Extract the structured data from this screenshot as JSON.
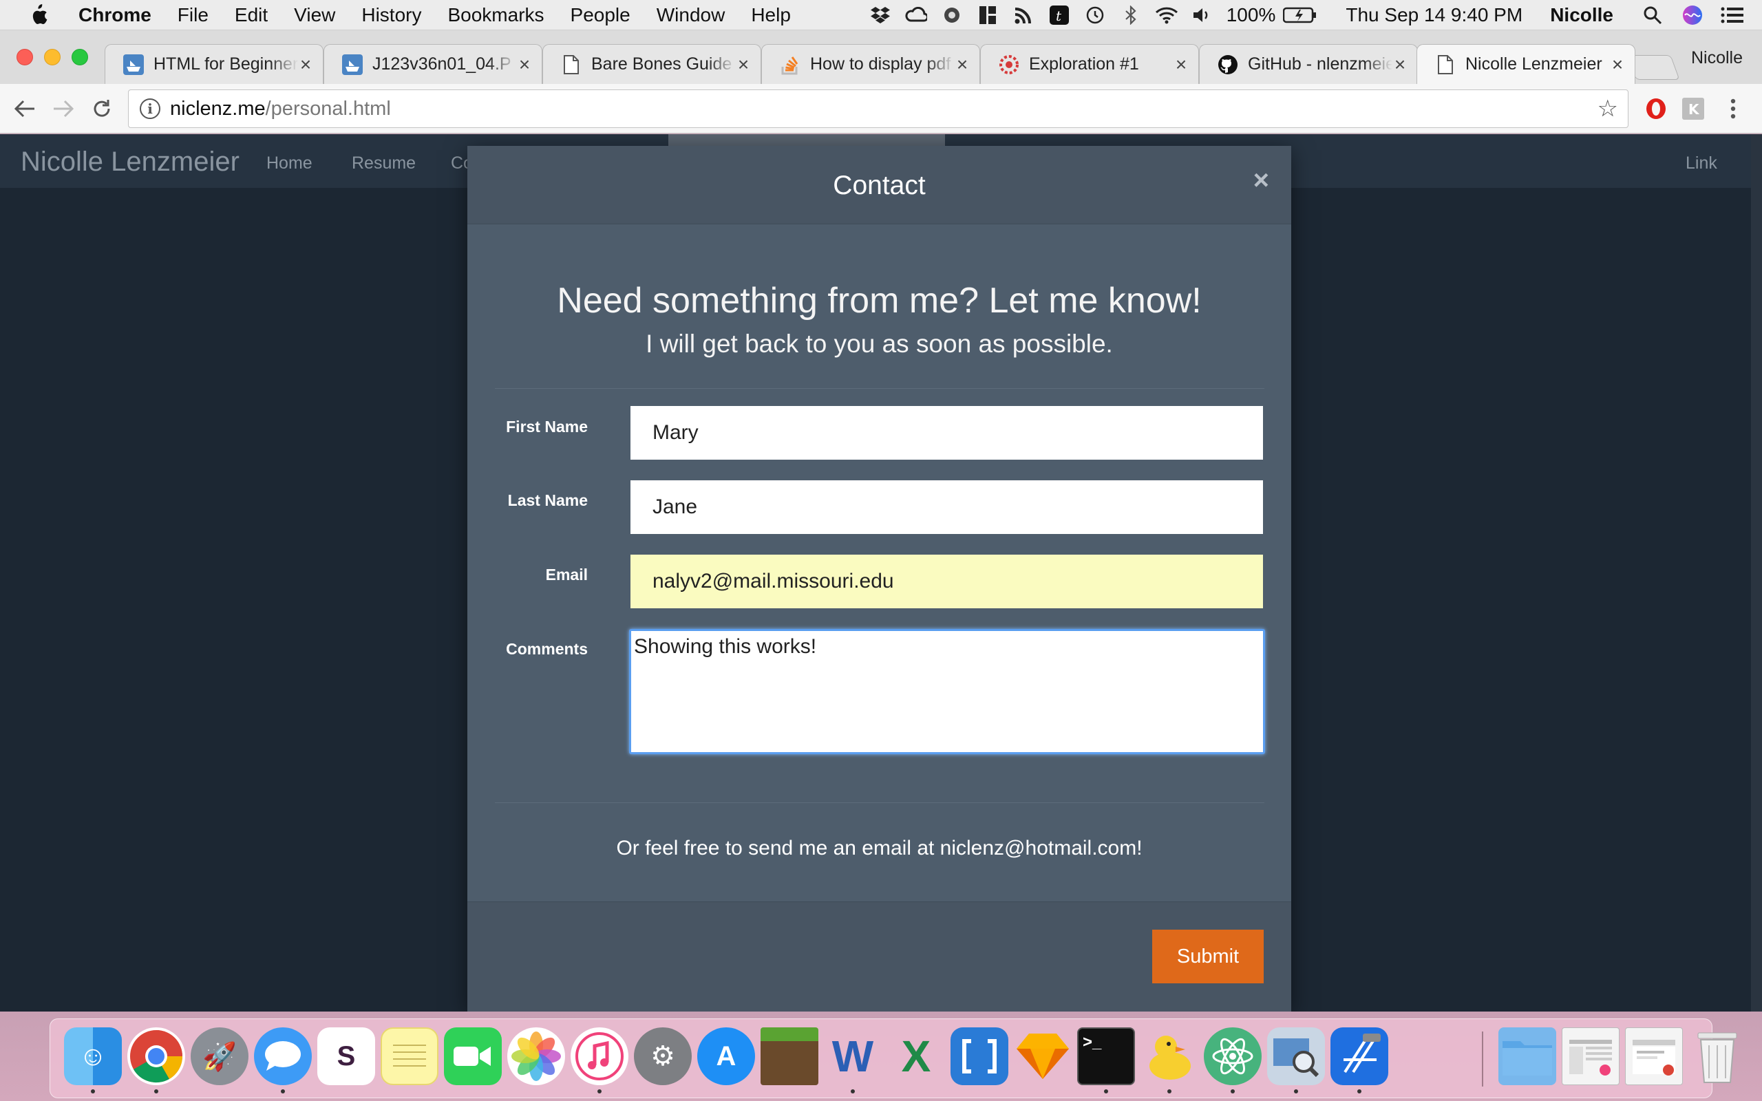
{
  "menubar": {
    "app_name": "Chrome",
    "menus": [
      "File",
      "Edit",
      "View",
      "History",
      "Bookmarks",
      "People",
      "Window",
      "Help"
    ],
    "battery": "100%",
    "datetime": "Thu Sep 14  9:40 PM",
    "user": "Nicolle",
    "status_icons": [
      "dropbox-icon",
      "creative-cloud-icon",
      "sync-icon",
      "grid-icon",
      "rss-icon",
      "typora-icon",
      "time-machine-icon",
      "bluetooth-icon",
      "wifi-icon",
      "volume-icon",
      "battery-icon",
      "spotlight-icon",
      "siri-icon",
      "notification-center-icon"
    ]
  },
  "tabs": [
    {
      "title": "HTML for Beginners",
      "favicon": "html-site-icon"
    },
    {
      "title": "J123v36n01_04.P",
      "favicon": "html-site-icon"
    },
    {
      "title": "Bare Bones Guide",
      "favicon": "document-icon"
    },
    {
      "title": "How to display pdf",
      "favicon": "stackoverflow-icon"
    },
    {
      "title": "Exploration #1",
      "favicon": "exploration-icon"
    },
    {
      "title": "GitHub - nlenzmeier",
      "favicon": "github-icon"
    },
    {
      "title": "Nicolle Lenzmeier",
      "favicon": "document-icon"
    }
  ],
  "profile_name": "Nicolle",
  "toolbar": {
    "url_host": "niclenz.me",
    "url_path": "/personal.html"
  },
  "site": {
    "brand": "Nicolle Lenzmeier",
    "nav": [
      "Home",
      "Resume",
      "Co"
    ],
    "nav_right": "Link"
  },
  "modal": {
    "title": "Contact",
    "close": "×",
    "headline": "Need something from me? Let me know!",
    "subline": "I will get back to you as soon as possible.",
    "fields": {
      "first_name": {
        "label": "First Name",
        "value": "Mary"
      },
      "last_name": {
        "label": "Last Name",
        "value": "Jane"
      },
      "email": {
        "label": "Email",
        "value": "nalyv2@mail.missouri.edu"
      },
      "comments": {
        "label": "Comments",
        "value": "Showing this works!"
      }
    },
    "email_note": "Or feel free to send me an email at niclenz@hotmail.com!",
    "submit": "Submit"
  },
  "dock": {
    "apps": [
      "Finder",
      "Chrome",
      "Launchpad",
      "Messages",
      "Slack",
      "Notes",
      "FaceTime",
      "Photos",
      "iTunes",
      "System Preferences",
      "App Store",
      "Minecraft",
      "Word",
      "Excel",
      "Brackets",
      "Sketch",
      "Terminal",
      "Cyberduck",
      "Atom",
      "Preview",
      "Xcode"
    ],
    "right_items": [
      "Downloads folder",
      "iTunes window",
      "Chrome window",
      "Trash"
    ]
  },
  "colors": {
    "accent": "#df691a",
    "modal_bg": "#4e5d6c",
    "page_bg": "#1c2733",
    "email_autofill": "#fafbc0",
    "focus_ring": "#5a9ef0"
  }
}
